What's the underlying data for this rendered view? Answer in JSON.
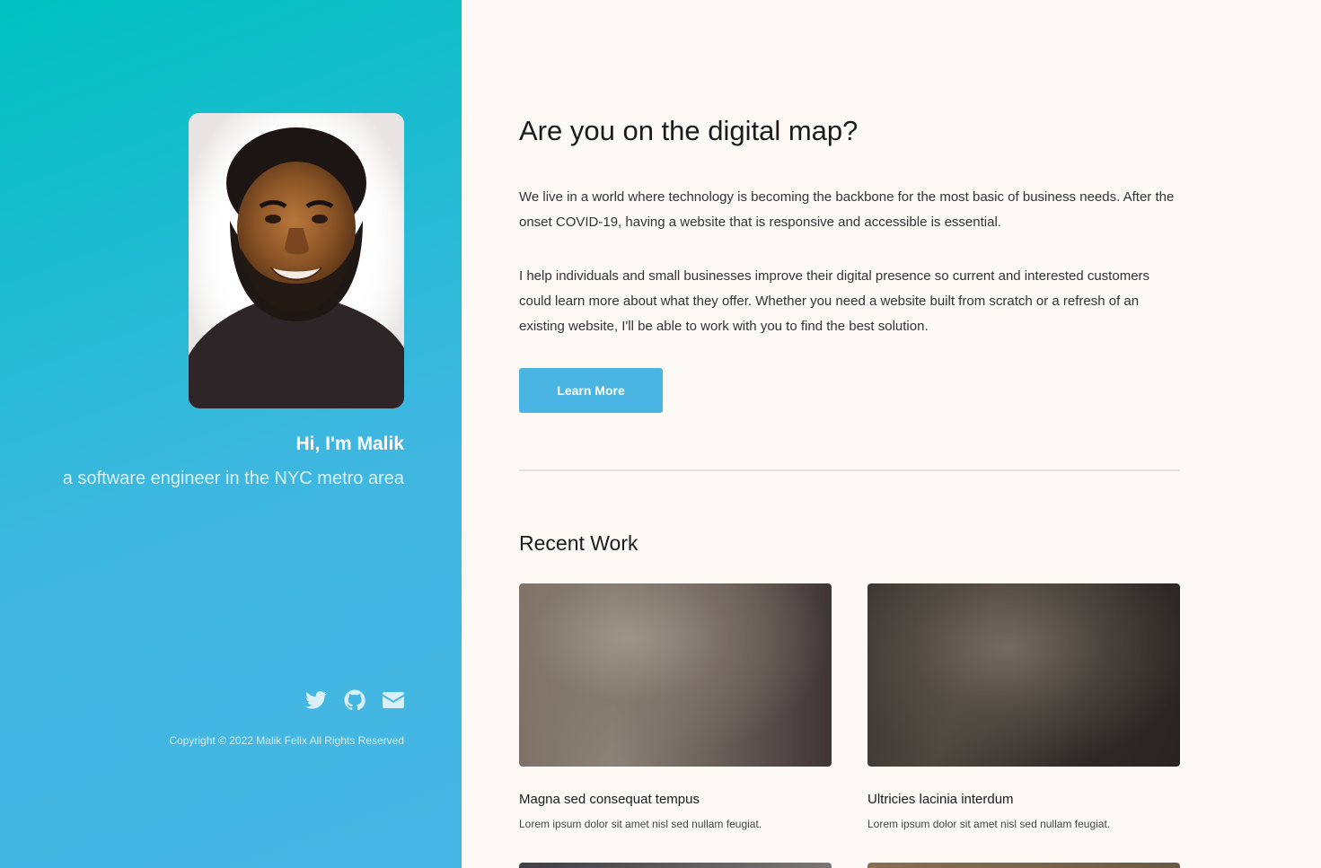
{
  "sidebar": {
    "avatar_alt": "Malik",
    "greeting": "Hi, I'm Malik",
    "tagline": "a software engineer in the NYC metro area",
    "socials": [
      {
        "icon": "twitter-icon"
      },
      {
        "icon": "github-icon"
      },
      {
        "icon": "envelope-icon"
      }
    ],
    "copyright": "Copyright © 2022 Malik Felix All Rights Reserved"
  },
  "main": {
    "headline": "Are you on the digital map?",
    "paragraphs": [
      "We live in a world where technology is becoming the backbone for the most basic of business needs. After the onset COVID-19, having a website that is responsive and accessible is essential.",
      "I help individuals and small businesses improve their digital presence so current and interested customers could learn more about what they offer. Whether you need a website built from scratch or a refresh of an existing website, I'll be able to work with you to find the best solution."
    ],
    "learn_more_label": "Learn More",
    "recent_work_title": "Recent Work",
    "works": [
      {
        "title": "Magna sed consequat tempus",
        "description": "Lorem ipsum dolor sit amet nisl sed nullam feugiat."
      },
      {
        "title": "Ultricies lacinia interdum",
        "description": "Lorem ipsum dolor sit amet nisl sed nullam feugiat."
      }
    ]
  },
  "colors": {
    "accent": "#4ab5e3",
    "sidebar_gradient_start": "#00c2c0",
    "sidebar_gradient_end": "#47b6e4",
    "background": "#fdfaf6"
  }
}
